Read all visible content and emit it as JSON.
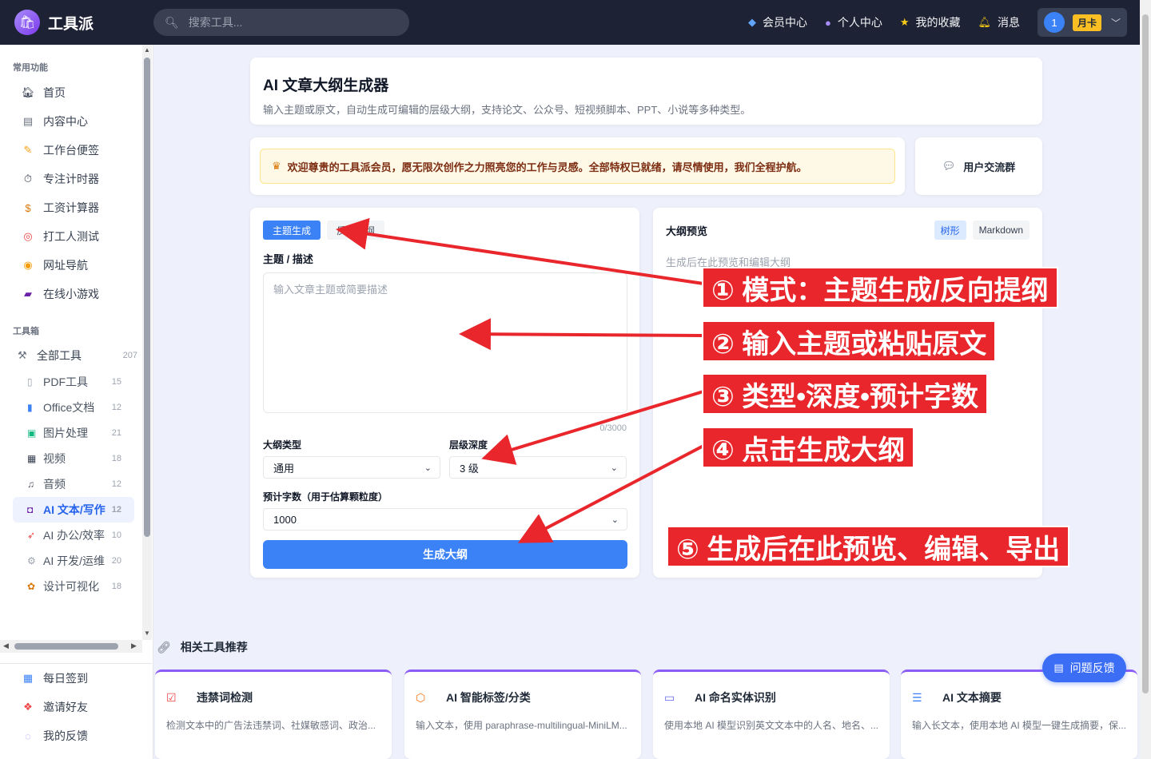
{
  "app": {
    "name": "工具派"
  },
  "search": {
    "placeholder": "搜索工具..."
  },
  "nav": {
    "vip": "会员中心",
    "profile": "个人中心",
    "favorites": "我的收藏",
    "messages": "消息",
    "user_count": "1",
    "user_badge": "月卡"
  },
  "sidebar": {
    "common_title": "常用功能",
    "common_items": [
      {
        "label": "首页",
        "icon": "house-icon"
      },
      {
        "label": "内容中心",
        "icon": "document-icon"
      },
      {
        "label": "工作台便签",
        "icon": "memo-icon"
      },
      {
        "label": "专注计时器",
        "icon": "stopwatch-icon"
      },
      {
        "label": "工资计算器",
        "icon": "money-bag-icon"
      },
      {
        "label": "打工人测试",
        "icon": "target-icon"
      },
      {
        "label": "网址导航",
        "icon": "compass-icon"
      },
      {
        "label": "在线小游戏",
        "icon": "gamepad-icon"
      }
    ],
    "toolbox_title": "工具箱",
    "all_tools": {
      "label": "全部工具",
      "count": "207"
    },
    "tool_items": [
      {
        "label": "PDF工具",
        "count": "15"
      },
      {
        "label": "Office文档",
        "count": "12"
      },
      {
        "label": "图片处理",
        "count": "21"
      },
      {
        "label": "视频",
        "count": "18"
      },
      {
        "label": "音频",
        "count": "12"
      },
      {
        "label": "AI 文本/写作",
        "count": "12"
      },
      {
        "label": "AI 办公/效率",
        "count": "10"
      },
      {
        "label": "AI 开发/运维",
        "count": "20"
      },
      {
        "label": "设计可视化",
        "count": "18"
      }
    ],
    "bottom_items": [
      {
        "label": "每日签到"
      },
      {
        "label": "邀请好友"
      },
      {
        "label": "我的反馈"
      }
    ]
  },
  "page": {
    "title": "AI 文章大纲生成器",
    "subtitle": "输入主题或原文，自动生成可编辑的层级大纲，支持论文、公众号、短视频脚本、PPT、小说等多种类型。",
    "welcome": "欢迎尊贵的工具派会员，愿无限次创作之力照亮您的工作与灵感。全部特权已就绪，请尽情使用，我们全程护航。",
    "user_group": "用户交流群"
  },
  "form": {
    "tab_topic": "主题生成",
    "tab_reverse": "反向提纲",
    "topic_label": "主题 / 描述",
    "topic_placeholder": "输入文章主题或简要描述",
    "counter": "0/3000",
    "type_label": "大纲类型",
    "type_value": "通用",
    "depth_label": "层级深度",
    "depth_value": "3 级",
    "words_label": "预计字数（用于估算颗粒度）",
    "words_value": "1000",
    "generate": "生成大纲"
  },
  "preview": {
    "title": "大纲预览",
    "tree": "树形",
    "markdown": "Markdown",
    "hint": "生成后在此预览和编辑大纲"
  },
  "related": {
    "title": "相关工具推荐",
    "cards": [
      {
        "title": "违禁词检测",
        "desc": "检测文本中的广告法违禁词、社媒敏感词、政治..."
      },
      {
        "title": "AI 智能标签/分类",
        "desc": "输入文本，使用 paraphrase-multilingual-MiniLM..."
      },
      {
        "title": "AI 命名实体识别",
        "desc": "使用本地 AI 模型识别英文文本中的人名、地名、..."
      },
      {
        "title": "AI 文本摘要",
        "desc": "输入长文本，使用本地 AI 模型一键生成摘要，保..."
      }
    ]
  },
  "feedback": {
    "label": "问题反馈"
  },
  "annotations": [
    "① 模式：主题生成/反向提纲",
    "② 输入主题或粘贴原文",
    "③ 类型•深度•预计字数",
    "④ 点击生成大纲",
    "⑤ 生成后在此预览、编辑、导出"
  ],
  "colors": {
    "accent": "#3b82f6",
    "annotation": "#e8262b",
    "topbar": "#1e2235"
  }
}
